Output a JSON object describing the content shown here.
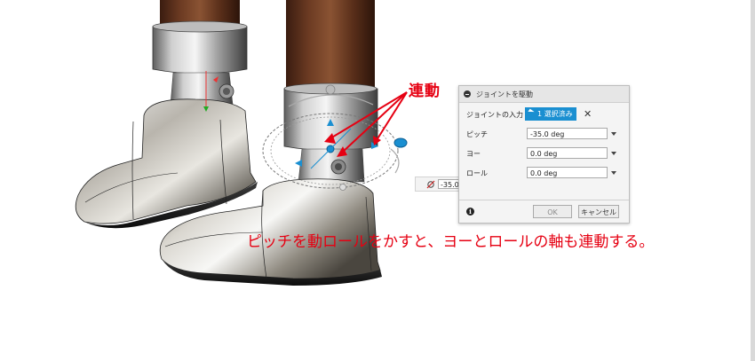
{
  "annotation": {
    "linked_label": "連動",
    "caption": "ピッチを動ロールをかすと、ヨーとロールの軸も連動する。",
    "color": "#e60012"
  },
  "panel": {
    "title": "ジョイントを駆動",
    "joint_input_label": "ジョイントの入力",
    "selection_label": "1 選択済み",
    "pitch_label": "ピッチ",
    "pitch_value": "-35.0 deg",
    "yaw_label": "ヨー",
    "yaw_value": "0.0 deg",
    "roll_label": "ロール",
    "roll_value": "0.0 deg",
    "ok_label": "OK",
    "cancel_label": "キャンセル",
    "accent_color": "#1a8fd1"
  },
  "manipulator": {
    "value": "-35.0 deg"
  }
}
